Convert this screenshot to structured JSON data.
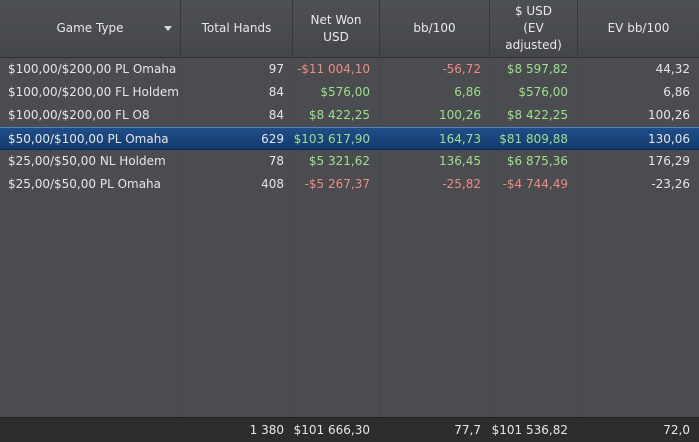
{
  "columns": [
    {
      "label": "Game Type"
    },
    {
      "label": "Total Hands"
    },
    {
      "label": "Net Won\nUSD"
    },
    {
      "label": "bb/100"
    },
    {
      "label": "$ USD\n(EV\nadjusted)"
    },
    {
      "label": "EV bb/100"
    }
  ],
  "rows": [
    {
      "game": "$100,00/$200,00 PL Omaha",
      "hands": "97",
      "net": "-$11 004,10",
      "net_sign": "neg",
      "bb": "-56,72",
      "bb_sign": "neg",
      "ev": "$8 597,82",
      "ev_sign": "pos",
      "evbb": "44,32"
    },
    {
      "game": "$100,00/$200,00 FL Holdem",
      "hands": "84",
      "net": "$576,00",
      "net_sign": "pos",
      "bb": "6,86",
      "bb_sign": "pos",
      "ev": "$576,00",
      "ev_sign": "pos",
      "evbb": "6,86"
    },
    {
      "game": "$100,00/$200,00 FL O8",
      "hands": "84",
      "net": "$8 422,25",
      "net_sign": "pos",
      "bb": "100,26",
      "bb_sign": "pos",
      "ev": "$8 422,25",
      "ev_sign": "pos",
      "evbb": "100,26"
    },
    {
      "game": "$50,00/$100,00 PL Omaha",
      "hands": "629",
      "net": "$103 617,90",
      "net_sign": "pos",
      "bb": "164,73",
      "bb_sign": "pos",
      "ev": "$81 809,88",
      "ev_sign": "pos",
      "evbb": "130,06",
      "selected": true
    },
    {
      "game": "$25,00/$50,00 NL Holdem",
      "hands": "78",
      "net": "$5 321,62",
      "net_sign": "pos",
      "bb": "136,45",
      "bb_sign": "pos",
      "ev": "$6 875,36",
      "ev_sign": "pos",
      "evbb": "176,29"
    },
    {
      "game": "$25,00/$50,00 PL Omaha",
      "hands": "408",
      "net": "-$5 267,37",
      "net_sign": "neg",
      "bb": "-25,82",
      "bb_sign": "neg",
      "ev": "-$4 744,49",
      "ev_sign": "neg",
      "evbb": "-23,26"
    }
  ],
  "totals": {
    "hands": "1 380",
    "net": "$101 666,30",
    "bb": "77,7",
    "ev": "$101 536,82",
    "evbb": "72,0"
  }
}
